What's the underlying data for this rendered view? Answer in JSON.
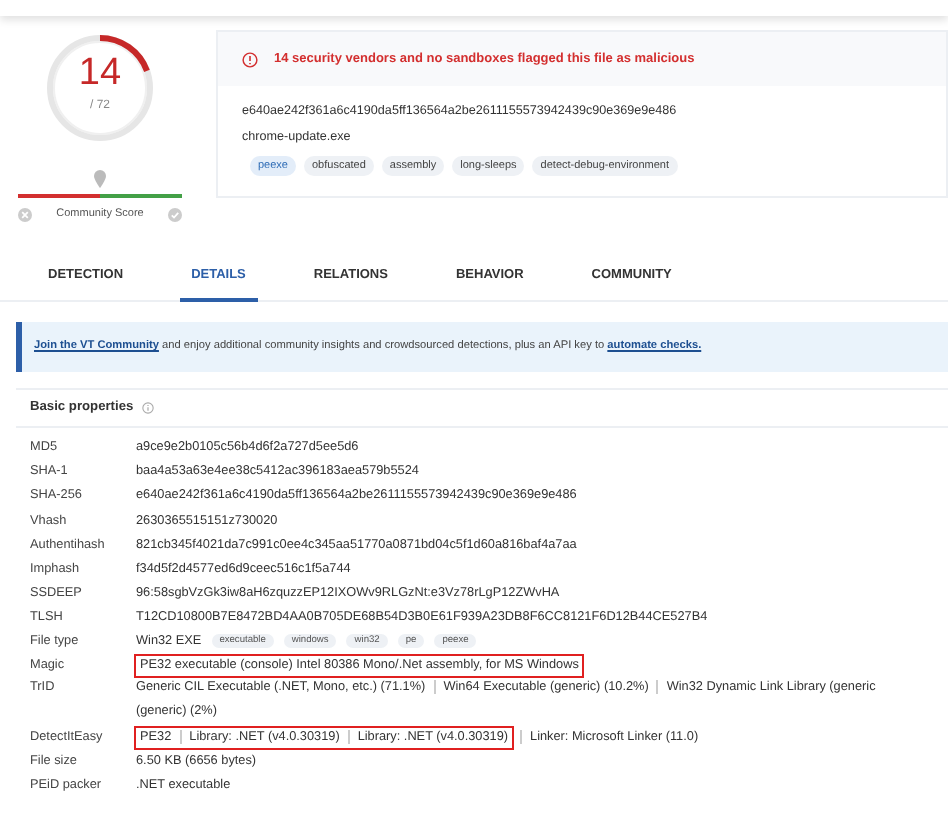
{
  "score": {
    "detections": "14",
    "total": "/ 72",
    "level": 0.194
  },
  "community_score": {
    "label": "Community Score"
  },
  "alert": "14 security vendors and no sandboxes flagged this file as malicious",
  "file": {
    "hash": "e640ae242f361a6c4190da5ff136564a2be2611155573942439c90e369e9e486",
    "name": "chrome-update.exe",
    "tags": [
      {
        "label": "peexe",
        "highlighted": true
      },
      {
        "label": "obfuscated",
        "highlighted": false
      },
      {
        "label": "assembly",
        "highlighted": false
      },
      {
        "label": "long-sleeps",
        "highlighted": false
      },
      {
        "label": "detect-debug-environment",
        "highlighted": false
      }
    ]
  },
  "tabs": [
    {
      "label": "DETECTION",
      "selected": false
    },
    {
      "label": "DETAILS",
      "selected": true
    },
    {
      "label": "RELATIONS",
      "selected": false
    },
    {
      "label": "BEHAVIOR",
      "selected": false
    },
    {
      "label": "COMMUNITY",
      "selected": false
    }
  ],
  "banner": [
    {
      "kind": "link",
      "text": "Join the VT Community"
    },
    {
      "kind": "text",
      "text": " and enjoy additional community insights and crowdsourced detections, plus an API key to "
    },
    {
      "kind": "link",
      "text": "automate checks."
    }
  ],
  "basic_properties": {
    "title": "Basic properties",
    "rows": [
      {
        "kind": "text",
        "label": "MD5",
        "value": "a9ce9e2b0105c56b4d6f2a727d5ee5d6",
        "highlighted": false
      },
      {
        "kind": "text",
        "label": "SHA-1",
        "value": "baa4a53a63e4ee38c5412ac396183aea579b5524",
        "highlighted": false
      },
      {
        "kind": "text",
        "label": "SHA-256",
        "value": "e640ae242f361a6c4190da5ff136564a2be2611155573942439c90e369e9e486",
        "highlighted": false
      },
      {
        "kind": "text",
        "label": "Vhash",
        "value": "2630365515151z730020",
        "highlighted": false
      },
      {
        "kind": "text",
        "label": "Authentihash",
        "value": "821cb345f4021da7c991c0ee4c345aa51770a0871bd04c5f1d60a816baf4a7aa",
        "highlighted": false
      },
      {
        "kind": "text",
        "label": "Imphash",
        "value": "f34d5f2d4577ed6d9ceec516c1f5a744",
        "highlighted": false
      },
      {
        "kind": "text",
        "label": "SSDEEP",
        "value": "96:58sgbVzGk3iw8aH6zquzzEP12IXOWv9RLGzNt:e3Vz78rLgP12ZWvHA",
        "highlighted": false
      },
      {
        "kind": "text",
        "label": "TLSH",
        "value": "T12CD10800B7E8472BD4AA0B705DE68B54D3B0E61F939A23DB8F6CC8121F6D12B44CE527B4",
        "highlighted": false
      },
      {
        "kind": "tags",
        "label": "File type",
        "value": "Win32 EXE",
        "tags": [
          "executable",
          "windows",
          "win32",
          "pe",
          "peexe"
        ]
      },
      {
        "kind": "text",
        "label": "Magic",
        "value": "PE32 executable (console) Intel 80386 Mono/.Net assembly, for MS Windows",
        "highlighted": true
      },
      {
        "kind": "parts",
        "label": "TrID",
        "parts": [
          {
            "text": "Generic CIL Executable (.NET, Mono, etc.) (71.1%)",
            "boxed": false
          },
          {
            "text": "Win64 Executable (generic) (10.2%)",
            "boxed": false
          },
          {
            "text": "Win32 Dynamic Link Library (generic",
            "boxed": false
          },
          {
            "text": "(generic) (2%)",
            "boxed": false
          }
        ]
      },
      {
        "kind": "parts",
        "label": "DetectItEasy",
        "parts": [
          {
            "text": "PE32",
            "boxed": true
          },
          {
            "text": "Library: .NET (v4.0.30319)",
            "boxed": true
          },
          {
            "text": "Library: .NET (v4.0.30319)",
            "boxed": true
          },
          {
            "text": "Linker: Microsoft Linker (11.0)",
            "boxed": false
          }
        ]
      },
      {
        "kind": "text",
        "label": "File size",
        "value": "6.50 KB (6656 bytes)",
        "highlighted": false
      },
      {
        "kind": "text",
        "label": "PEiD packer",
        "value": ".NET executable",
        "highlighted": false
      }
    ]
  }
}
